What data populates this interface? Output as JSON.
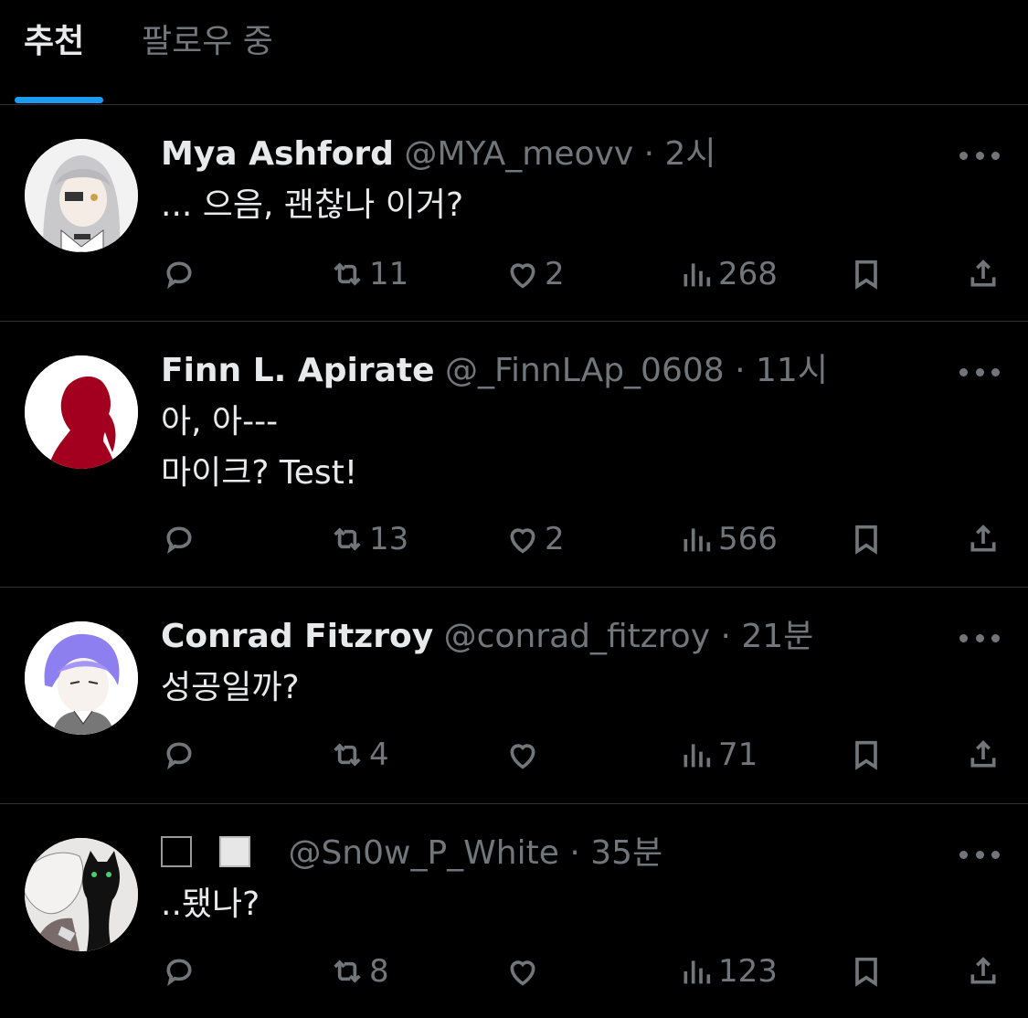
{
  "tabs": {
    "recommended": "추천",
    "following": "팔로우 중"
  },
  "colors": {
    "accent": "#1d9bf0",
    "muted": "#71767b",
    "text": "#e7e9ea",
    "divider": "#2f3336"
  },
  "tweets": [
    {
      "name": "Mya Ashford",
      "handle": "@MYA_meovv",
      "sep": "·",
      "time": "2시",
      "text": "... 으음, 괜찮나 이거?",
      "reply_count": "",
      "retweets": "11",
      "likes": "2",
      "views": "268",
      "avatar": "silver-hair-character-avatar"
    },
    {
      "name": "Finn L. Apirate",
      "handle": "@_FinnLAp_0608",
      "sep": "·",
      "time": "11시",
      "text": "아, 아---\n마이크? Test!",
      "retweets": "13",
      "likes": "2",
      "views": "566",
      "avatar": "red-silhouette-avatar"
    },
    {
      "name": "Conrad Fitzroy",
      "handle": "@conrad_fitzroy",
      "sep": "·",
      "time": "21분",
      "text": "성공일까?",
      "retweets": "4",
      "likes": "",
      "views": "71",
      "avatar": "purple-hair-character-avatar"
    },
    {
      "name": "",
      "handle": "@Sn0w_P_White",
      "sep": "·",
      "time": "35분",
      "text": "..됐나?",
      "retweets": "8",
      "likes": "",
      "views": "123",
      "avatar": "white-hair-character-with-black-cat-avatar"
    }
  ]
}
